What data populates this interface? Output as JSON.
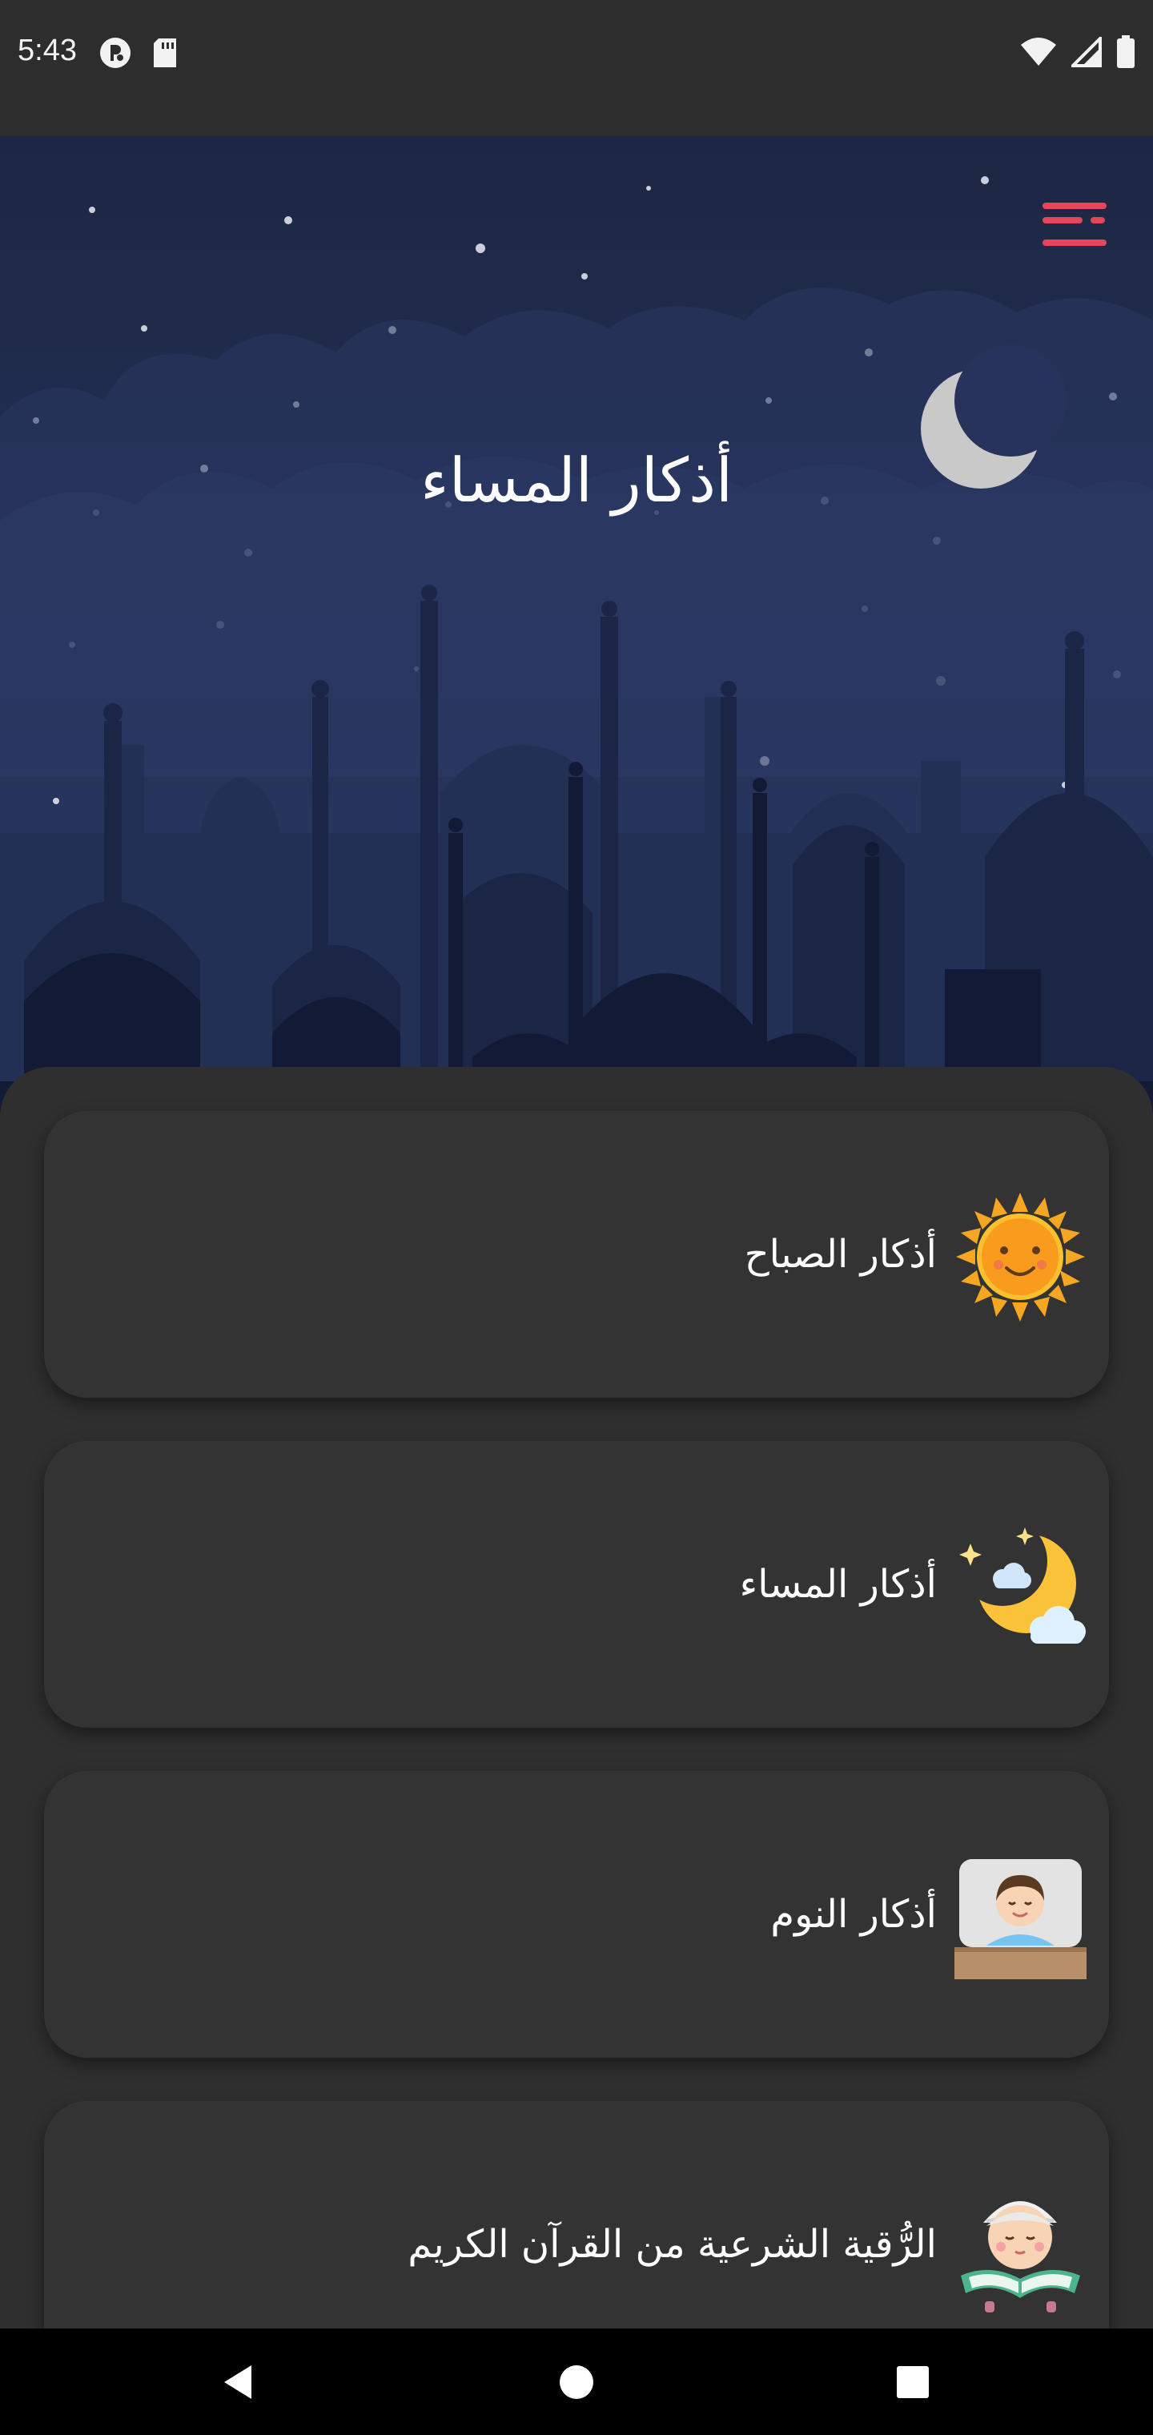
{
  "status_bar": {
    "time": "5:43",
    "left_icons": [
      "notification-app-icon",
      "sd-card-icon"
    ],
    "right_icons": [
      "wifi-icon",
      "signal-icon",
      "battery-icon"
    ]
  },
  "header": {
    "title": "أذكار المساء",
    "menu_icon": "menu-icon",
    "accent_color": "#e8445a"
  },
  "cards": [
    {
      "label": "أذكار الصباح",
      "icon": "sun-icon"
    },
    {
      "label": "أذكار المساء",
      "icon": "moon-clouds-icon"
    },
    {
      "label": "أذكار النوم",
      "icon": "sleeping-boy-icon"
    },
    {
      "label": "الرُّقية الشرعية من القرآن الكريم",
      "icon": "boy-reading-quran-icon"
    }
  ],
  "nav_bar": {
    "buttons": [
      "back-icon",
      "home-icon",
      "recents-icon"
    ]
  }
}
